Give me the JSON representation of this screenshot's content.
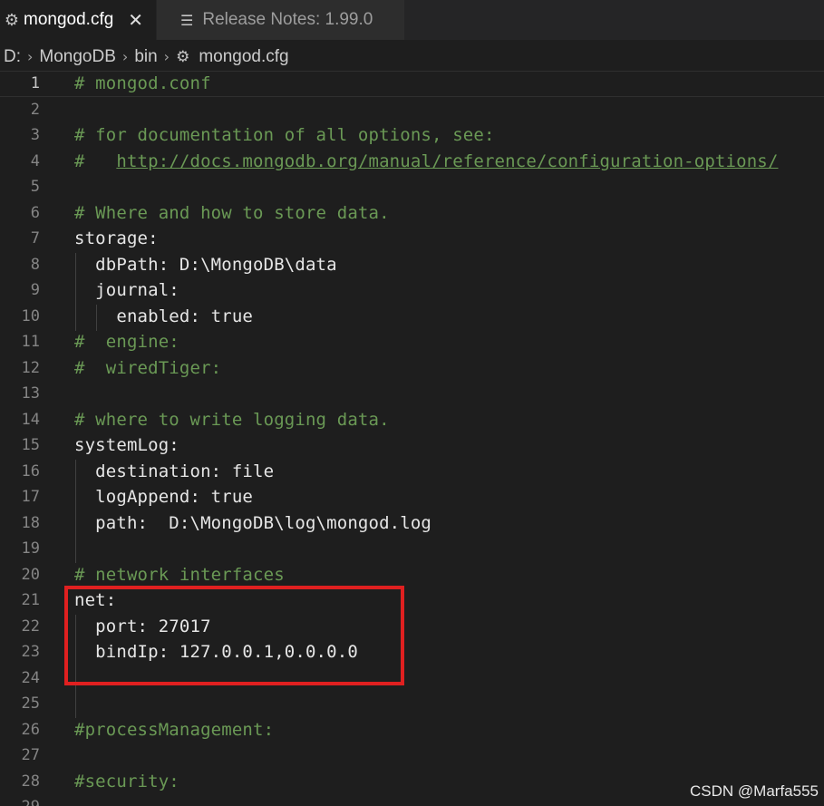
{
  "tabs": [
    {
      "label": "mongod.cfg",
      "icon": "gear-icon",
      "active": true
    },
    {
      "label": "Release Notes: 1.99.0",
      "icon": "document-icon",
      "active": false
    }
  ],
  "breadcrumb": {
    "items": [
      "D:",
      "MongoDB",
      "bin",
      "mongod.cfg"
    ]
  },
  "editor": {
    "lines": [
      {
        "n": "1",
        "text": "# mongod.conf"
      },
      {
        "n": "2",
        "text": ""
      },
      {
        "n": "3",
        "text": "# for documentation of all options, see:"
      },
      {
        "n": "4",
        "prefix": "#   ",
        "link": "http://docs.mongodb.org/manual/reference/configuration-options/"
      },
      {
        "n": "5",
        "text": ""
      },
      {
        "n": "6",
        "text": "# Where and how to store data."
      },
      {
        "n": "7",
        "text": "storage:"
      },
      {
        "n": "8",
        "text": "  dbPath: D:\\MongoDB\\data"
      },
      {
        "n": "9",
        "text": "  journal:"
      },
      {
        "n": "10",
        "text": "    enabled: true"
      },
      {
        "n": "11",
        "text": "#  engine:"
      },
      {
        "n": "12",
        "text": "#  wiredTiger:"
      },
      {
        "n": "13",
        "text": ""
      },
      {
        "n": "14",
        "text": "# where to write logging data."
      },
      {
        "n": "15",
        "text": "systemLog:"
      },
      {
        "n": "16",
        "text": "  destination: file"
      },
      {
        "n": "17",
        "text": "  logAppend: true"
      },
      {
        "n": "18",
        "text": "  path:  D:\\MongoDB\\log\\mongod.log"
      },
      {
        "n": "19",
        "text": ""
      },
      {
        "n": "20",
        "text": "# network interfaces"
      },
      {
        "n": "21",
        "text": "net:"
      },
      {
        "n": "22",
        "text": "  port: 27017"
      },
      {
        "n": "23",
        "text": "  bindIp: 127.0.0.1,0.0.0.0"
      },
      {
        "n": "24",
        "text": ""
      },
      {
        "n": "25",
        "text": ""
      },
      {
        "n": "26",
        "text": "#processManagement:"
      },
      {
        "n": "27",
        "text": ""
      },
      {
        "n": "28",
        "text": "#security:"
      },
      {
        "n": "29",
        "text": ""
      }
    ]
  },
  "watermark": "CSDN @Marfa555",
  "colors": {
    "comment": "#6a9955",
    "highlight_box": "#e02020",
    "background": "#1e1e1e"
  }
}
